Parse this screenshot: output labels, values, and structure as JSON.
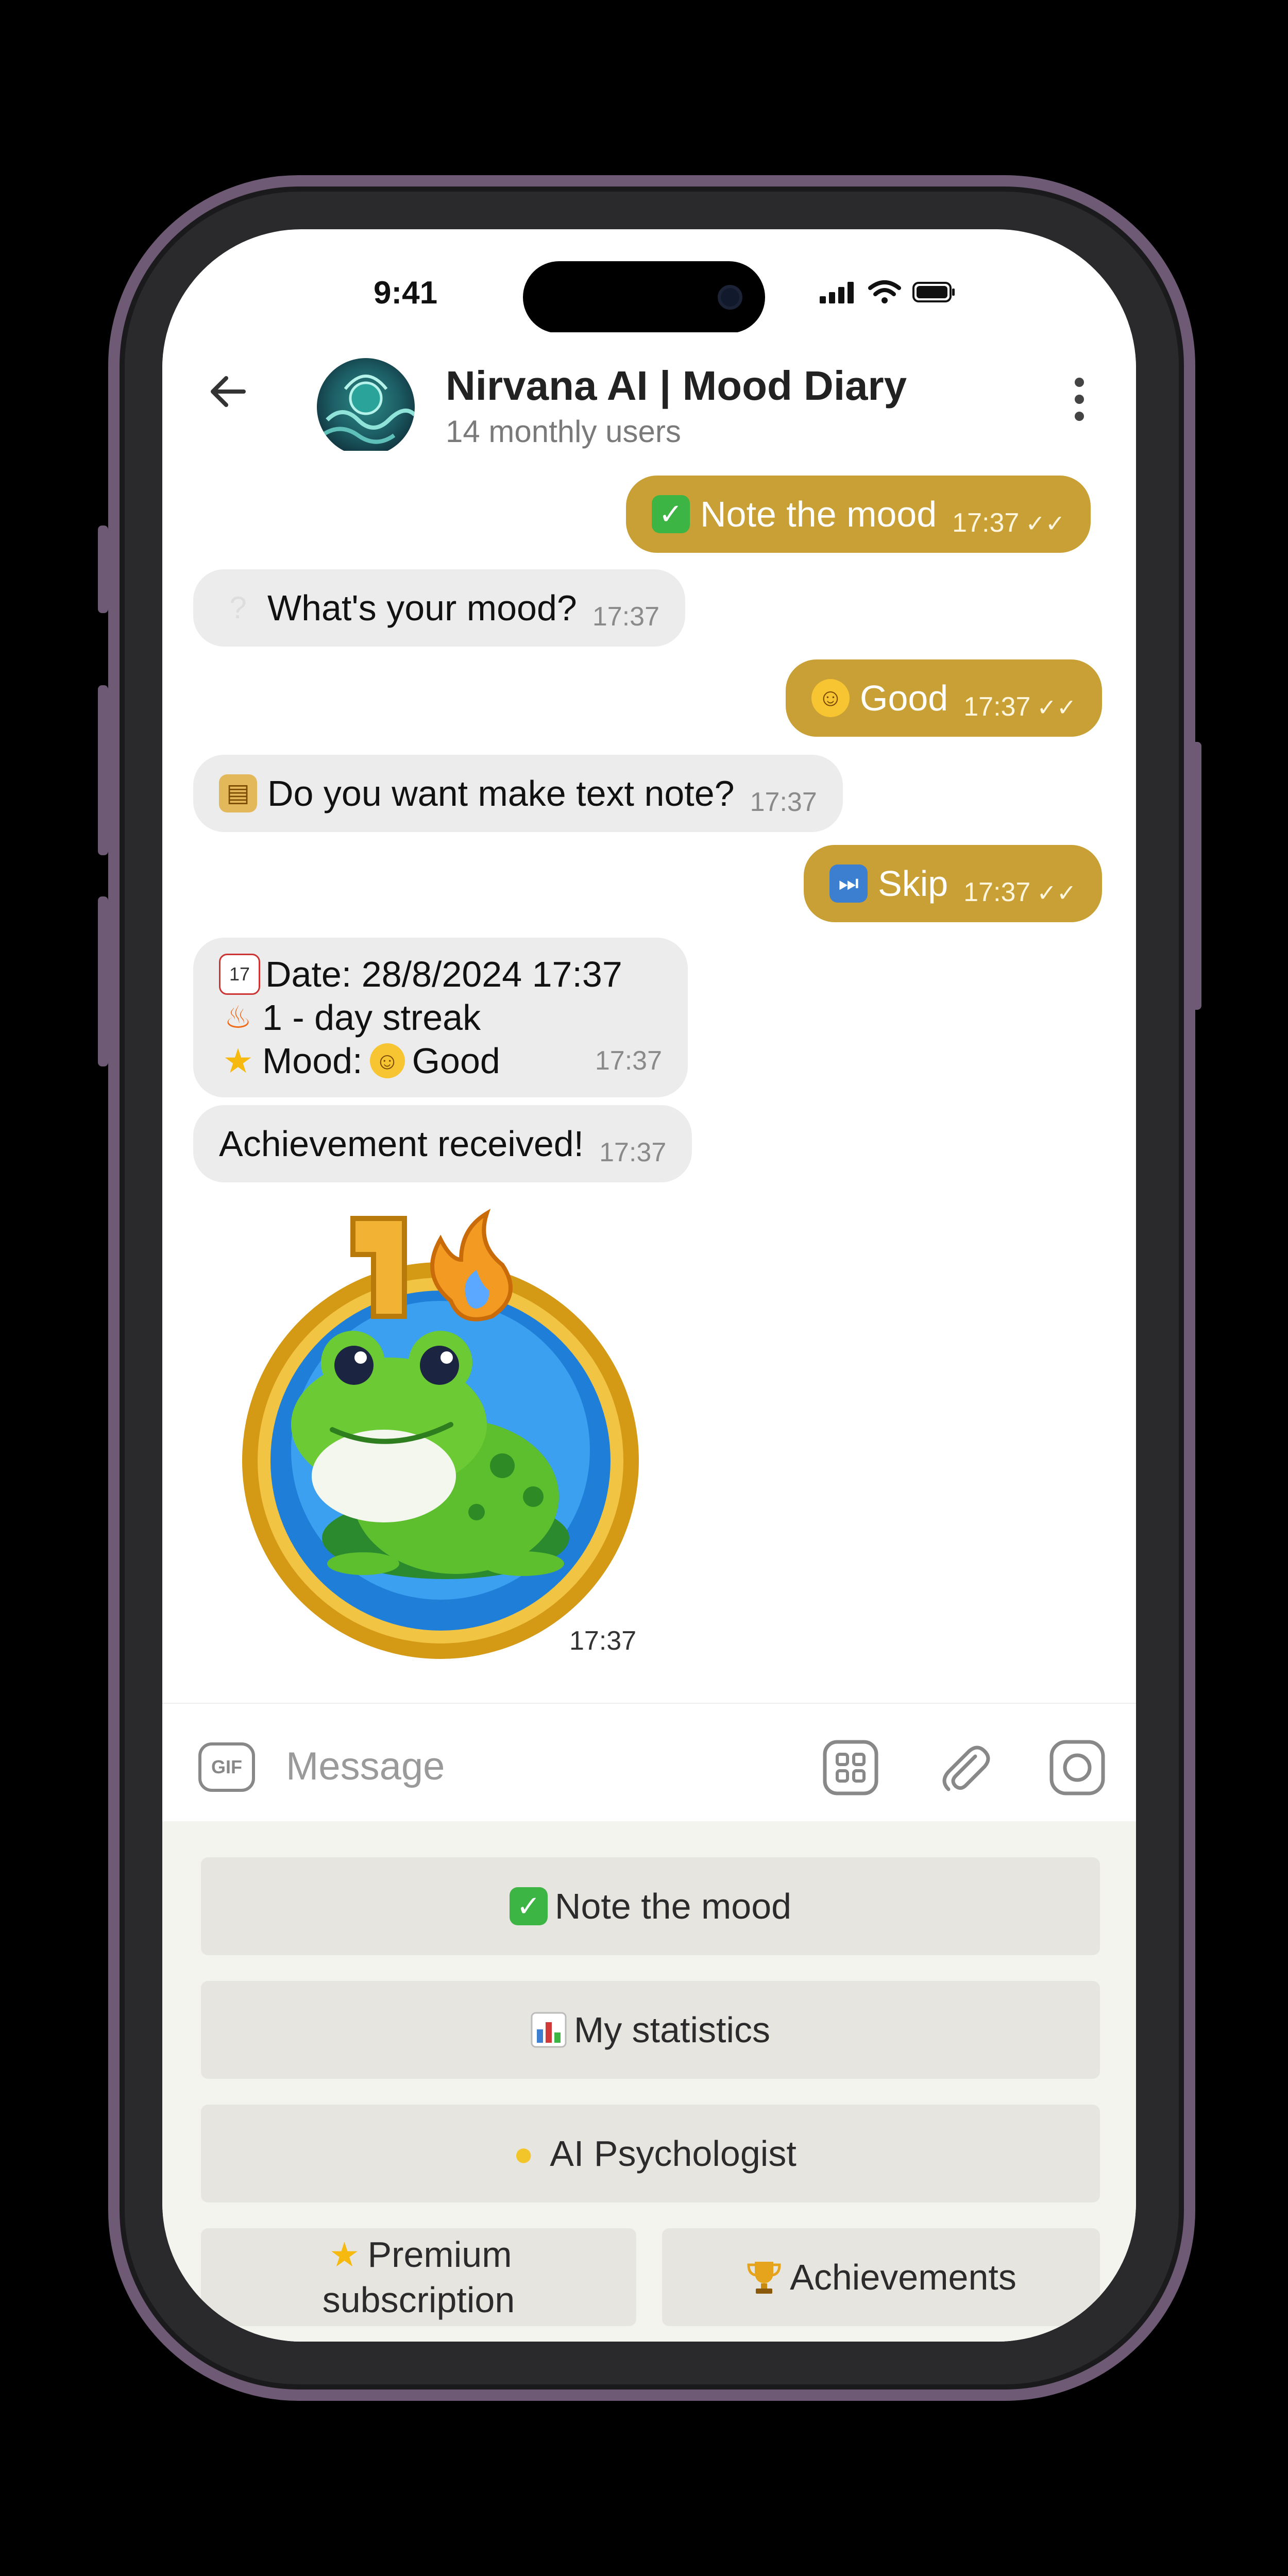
{
  "status": {
    "time": "9:41"
  },
  "header": {
    "title": "Nirvana AI | Mood Diary",
    "subtitle": "14 monthly users"
  },
  "messages": [
    {
      "text": "Note the mood",
      "time": "17:37",
      "icon": "check-mark-emoji"
    },
    {
      "text": "What's your mood?",
      "time": "17:37",
      "icon": "question-mark-emoji"
    },
    {
      "text": "Good",
      "time": "17:37",
      "icon": "smiling-face-emoji"
    },
    {
      "text": "Do you want make text note?",
      "time": "17:37",
      "icon": "notebook-emoji"
    },
    {
      "text": "Skip",
      "time": "17:37",
      "icon": "skip-emoji"
    },
    {
      "line1": "Date: 28/8/2024 17:37",
      "line2": "1 - day streak",
      "line3a": "Mood:",
      "line3b": "Good",
      "time": "17:37"
    },
    {
      "text": "Achievement received!",
      "time": "17:37"
    },
    {
      "sticker_badge": "1",
      "time": "17:37"
    }
  ],
  "input": {
    "placeholder": "Message",
    "gif": "GIF"
  },
  "keyboard": {
    "note": "Note the mood",
    "stats": "My statistics",
    "psych": "AI Psychologist",
    "premium_l1": "Premium",
    "premium_l2": "subscription",
    "achievements": "Achievements"
  },
  "colors": {
    "outgoing": "#c8a035",
    "incoming": "#ececec",
    "keyboard_bg": "#f4f4ef",
    "frame": "#6e5a74"
  }
}
